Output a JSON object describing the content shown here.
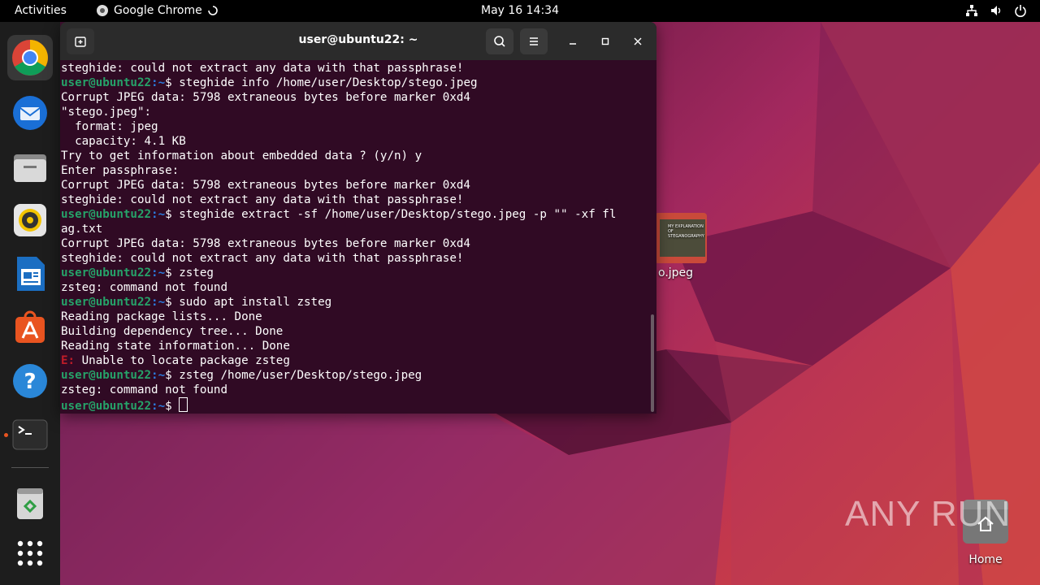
{
  "topbar": {
    "activities": "Activities",
    "app_name": "Google Chrome",
    "clock": "May 16  14:34"
  },
  "dock": {
    "items": [
      {
        "name": "chrome-icon"
      },
      {
        "name": "thunderbird-icon"
      },
      {
        "name": "files-icon"
      },
      {
        "name": "rhythmbox-icon"
      },
      {
        "name": "libreoffice-writer-icon"
      },
      {
        "name": "app-center-icon"
      },
      {
        "name": "help-icon"
      },
      {
        "name": "terminal-icon"
      },
      {
        "name": "trash-icon"
      },
      {
        "name": "show-apps-icon"
      }
    ]
  },
  "desktop": {
    "icons": [
      {
        "label": "o.jpeg",
        "thumb_text": "MY EXPLANATION OF STEGANOGRAPHY"
      },
      {
        "label": "Home"
      }
    ],
    "watermark": "ANY RUN"
  },
  "terminal": {
    "title": "user@ubuntu22: ~",
    "prompt_user": "user@ubuntu22",
    "prompt_path": ":~",
    "prompt_symbol": "$ ",
    "lines": [
      {
        "type": "out",
        "text": "steghide: could not extract any data with that passphrase!"
      },
      {
        "type": "cmd",
        "text": "steghide info /home/user/Desktop/stego.jpeg"
      },
      {
        "type": "out",
        "text": "Corrupt JPEG data: 5798 extraneous bytes before marker 0xd4"
      },
      {
        "type": "out",
        "text": "\"stego.jpeg\":"
      },
      {
        "type": "out",
        "text": "  format: jpeg"
      },
      {
        "type": "out",
        "text": "  capacity: 4.1 KB"
      },
      {
        "type": "out",
        "text": "Try to get information about embedded data ? (y/n) y"
      },
      {
        "type": "out",
        "text": "Enter passphrase:"
      },
      {
        "type": "out",
        "text": "Corrupt JPEG data: 5798 extraneous bytes before marker 0xd4"
      },
      {
        "type": "out",
        "text": "steghide: could not extract any data with that passphrase!"
      },
      {
        "type": "cmd",
        "text": "steghide extract -sf /home/user/Desktop/stego.jpeg -p \"\" -xf fl"
      },
      {
        "type": "out",
        "text": "ag.txt"
      },
      {
        "type": "out",
        "text": "Corrupt JPEG data: 5798 extraneous bytes before marker 0xd4"
      },
      {
        "type": "out",
        "text": "steghide: could not extract any data with that passphrase!"
      },
      {
        "type": "cmd",
        "text": "zsteg"
      },
      {
        "type": "out",
        "text": "zsteg: command not found"
      },
      {
        "type": "cmd",
        "text": "sudo apt install zsteg"
      },
      {
        "type": "out",
        "text": "Reading package lists... Done"
      },
      {
        "type": "out",
        "text": "Building dependency tree... Done"
      },
      {
        "type": "out",
        "text": "Reading state information... Done"
      },
      {
        "type": "err",
        "prefix": "E:",
        "text": " Unable to locate package zsteg"
      },
      {
        "type": "cmd",
        "text": "zsteg /home/user/Desktop/stego.jpeg"
      },
      {
        "type": "out",
        "text": "zsteg: command not found"
      },
      {
        "type": "cmd",
        "text": ""
      }
    ]
  }
}
